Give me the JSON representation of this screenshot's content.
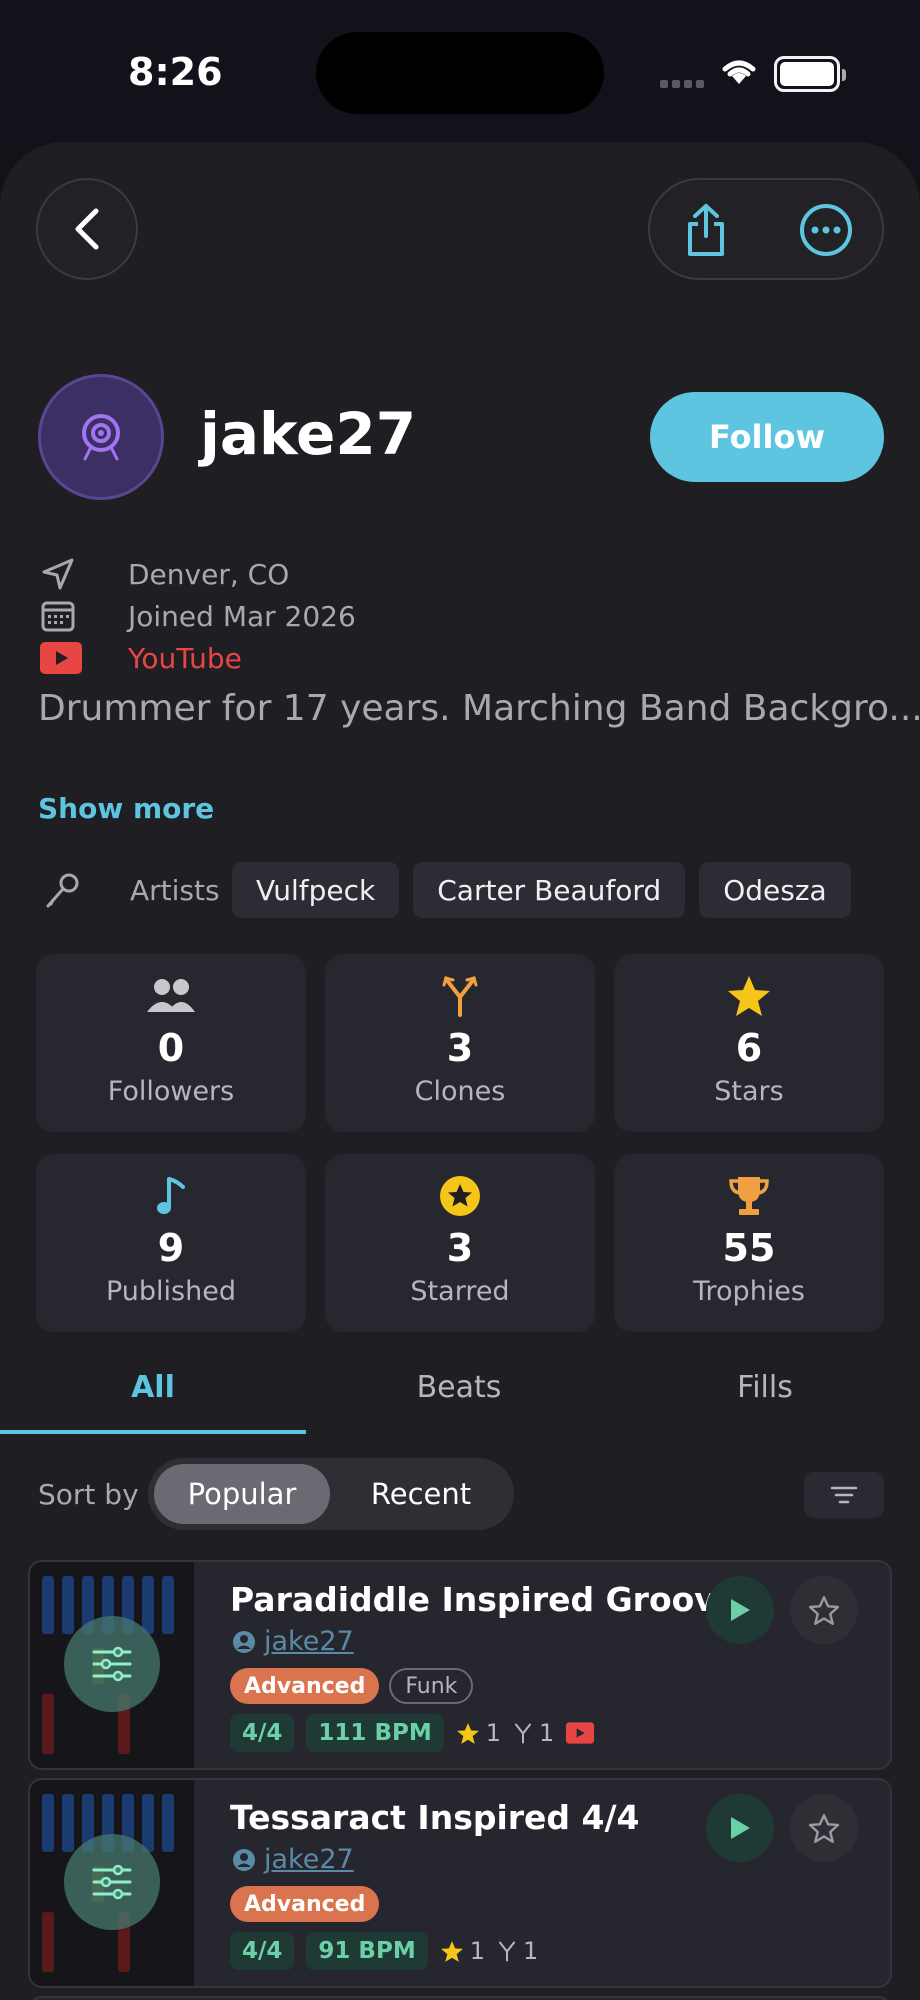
{
  "status_bar": {
    "time": "8:26"
  },
  "profile": {
    "username": "jake27",
    "follow_label": "Follow",
    "location": "Denver, CO",
    "joined": "Joined Mar 2026",
    "youtube": "YouTube",
    "bio": "Drummer for 17 years. Marching Band Backgro...",
    "show_more": "Show more",
    "artists_label": "Artists",
    "artists": [
      "Vulfpeck",
      "Carter Beauford",
      "Odesza"
    ]
  },
  "stats": [
    {
      "value": "0",
      "label": "Followers",
      "icon": "people-icon",
      "color": "#c8c8cc"
    },
    {
      "value": "3",
      "label": "Clones",
      "icon": "fork-icon",
      "color": "#f0a040"
    },
    {
      "value": "6",
      "label": "Stars",
      "icon": "star-icon",
      "color": "#f5c518"
    },
    {
      "value": "9",
      "label": "Published",
      "icon": "music-note-icon",
      "color": "#5ec5e0"
    },
    {
      "value": "3",
      "label": "Starred",
      "icon": "star-circle-icon",
      "color": "#f5c518"
    },
    {
      "value": "55",
      "label": "Trophies",
      "icon": "trophy-icon",
      "color": "#f0a040"
    }
  ],
  "tabs": [
    "All",
    "Beats",
    "Fills"
  ],
  "sort": {
    "label": "Sort by",
    "options": [
      "Popular",
      "Recent"
    ],
    "selected": "Popular"
  },
  "grooves": [
    {
      "title": "Paradiddle Inspired Groove",
      "author": "jake27",
      "level": "Advanced",
      "genre": "Funk",
      "time_sig": "4/4",
      "bpm": "111 BPM",
      "stars": "1",
      "clones": "1",
      "has_youtube": true
    },
    {
      "title": "Tessaract Inspired 4/4",
      "author": "jake27",
      "level": "Advanced",
      "genre": "",
      "time_sig": "4/4",
      "bpm": "91 BPM",
      "stars": "1",
      "clones": "1",
      "has_youtube": false
    }
  ],
  "colors": {
    "accent": "#5ec5e0",
    "youtube": "#e84545",
    "level": "#d9744e",
    "green": "#6bd0a8"
  }
}
